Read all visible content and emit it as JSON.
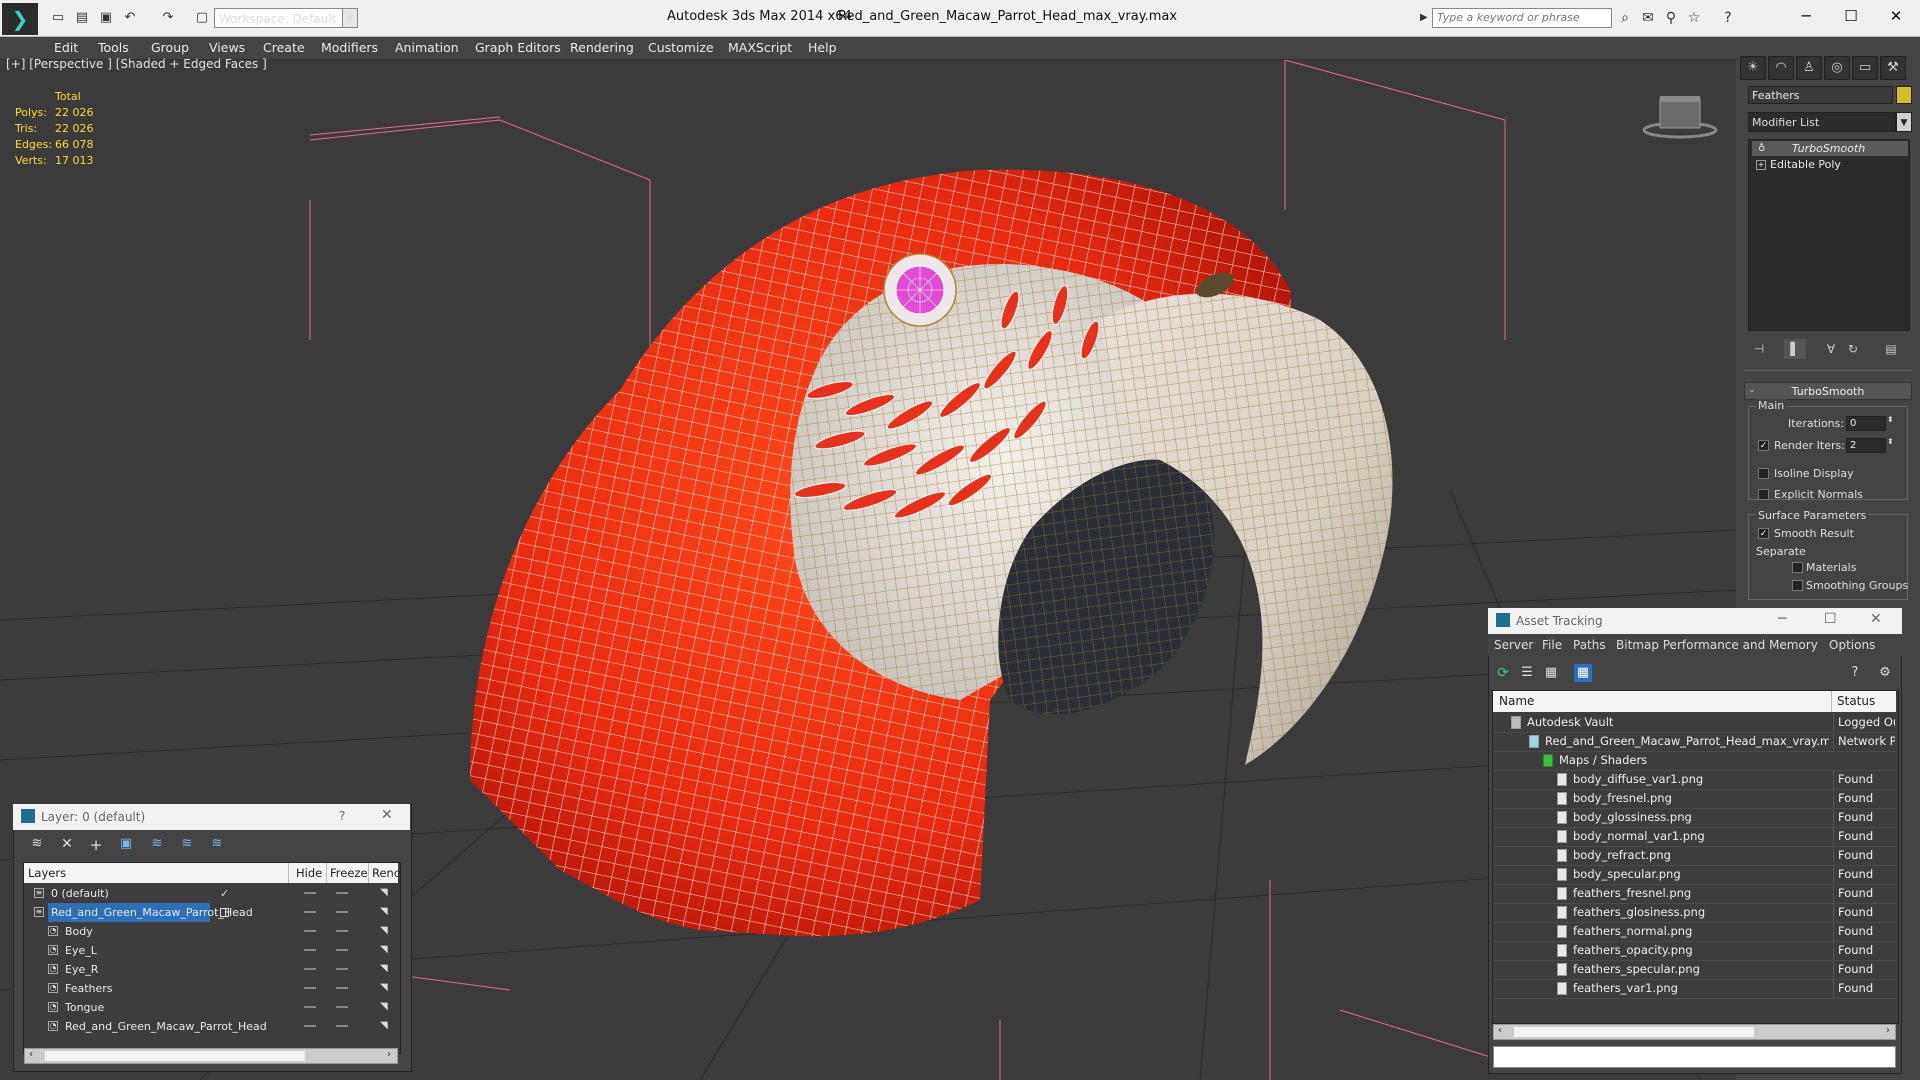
{
  "titlebar": {
    "workspace_label": "Workspace: Default",
    "app_title": "Autodesk 3ds Max  2014 x64",
    "file_title": "Red_and_Green_Macaw_Parrot_Head_max_vray.max",
    "search_placeholder": "Type a keyword or phrase"
  },
  "menu": {
    "items": [
      "Edit",
      "Tools",
      "Group",
      "Views",
      "Create",
      "Modifiers",
      "Animation",
      "Graph Editors",
      "Rendering",
      "Customize",
      "MAXScript",
      "Help"
    ]
  },
  "viewport": {
    "label": "[+] [Perspective ] [Shaded + Edged Faces ]",
    "stats": {
      "header": "Total",
      "rows": [
        {
          "label": "Polys:",
          "value": "22 026"
        },
        {
          "label": "Tris:",
          "value": "22 026"
        },
        {
          "label": "Edges:",
          "value": "66 078"
        },
        {
          "label": "Verts:",
          "value": "17 013"
        }
      ]
    }
  },
  "command_panel": {
    "object_name": "Feathers",
    "object_color": "#d4ba30",
    "modifier_list": "Modifier List",
    "stack": [
      "TurboSmooth",
      "Editable Poly"
    ],
    "rollout_title": "TurboSmooth",
    "main_group": "Main",
    "iterations_label": "Iterations:",
    "iterations_value": "0",
    "render_iters_label": "Render Iters:",
    "render_iters_value": "2",
    "isoline_label": "Isoline Display",
    "explicit_normals_label": "Explicit Normals",
    "surface_group": "Surface Parameters",
    "smooth_result_label": "Smooth Result",
    "separate_label": "Separate",
    "materials_label": "Materials",
    "smoothing_groups_label": "Smoothing Groups"
  },
  "asset_tracking": {
    "title": "Asset Tracking",
    "menu": [
      "Server",
      "File",
      "Paths",
      "Bitmap Performance and Memory",
      "Options"
    ],
    "columns": {
      "name": "Name",
      "status": "Status"
    },
    "rows": [
      {
        "name": "Autodesk Vault",
        "status": "Logged Ou",
        "level": 0
      },
      {
        "name": "Red_and_Green_Macaw_Parrot_Head_max_vray.max",
        "status": "Network Pa",
        "level": 1
      },
      {
        "name": "Maps / Shaders",
        "status": "",
        "level": 2
      },
      {
        "name": "body_diffuse_var1.png",
        "status": "Found",
        "level": 3
      },
      {
        "name": "body_fresnel.png",
        "status": "Found",
        "level": 3
      },
      {
        "name": "body_glossiness.png",
        "status": "Found",
        "level": 3
      },
      {
        "name": "body_normal_var1.png",
        "status": "Found",
        "level": 3
      },
      {
        "name": "body_refract.png",
        "status": "Found",
        "level": 3
      },
      {
        "name": "body_specular.png",
        "status": "Found",
        "level": 3
      },
      {
        "name": "feathers_fresnel.png",
        "status": "Found",
        "level": 3
      },
      {
        "name": "feathers_glosiness.png",
        "status": "Found",
        "level": 3
      },
      {
        "name": "feathers_normal.png",
        "status": "Found",
        "level": 3
      },
      {
        "name": "feathers_opacity.png",
        "status": "Found",
        "level": 3
      },
      {
        "name": "feathers_specular.png",
        "status": "Found",
        "level": 3
      },
      {
        "name": "feathers_var1.png",
        "status": "Found",
        "level": 3
      }
    ]
  },
  "layer_window": {
    "title": "Layer: 0 (default)",
    "help": "?",
    "columns": {
      "layers": "Layers",
      "hide": "Hide",
      "freeze": "Freeze",
      "render": "Renc"
    },
    "rows": [
      {
        "name": "0 (default)",
        "level": 0,
        "selected": false
      },
      {
        "name": "Red_and_Green_Macaw_Parrot_Head",
        "level": 0,
        "selected": true
      },
      {
        "name": "Body",
        "level": 1,
        "selected": false
      },
      {
        "name": "Eye_L",
        "level": 1,
        "selected": false
      },
      {
        "name": "Eye_R",
        "level": 1,
        "selected": false
      },
      {
        "name": "Feathers",
        "level": 1,
        "selected": false
      },
      {
        "name": "Tongue",
        "level": 1,
        "selected": false
      },
      {
        "name": "Red_and_Green_Macaw_Parrot_Head",
        "level": 1,
        "selected": false
      }
    ]
  }
}
